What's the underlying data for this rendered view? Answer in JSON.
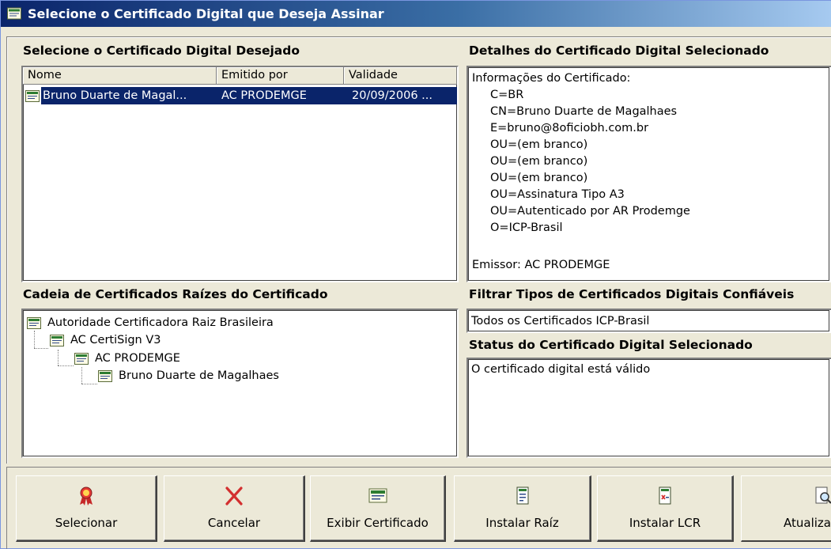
{
  "window": {
    "title": "Selecione o Certificado Digital que Deseja Assinar"
  },
  "certificates": {
    "label": "Selecione o Certificado Digital Desejado",
    "columns": [
      "Nome",
      "Emitido por",
      "Validade"
    ],
    "rows": [
      {
        "name": "Bruno Duarte de Magal...",
        "issuer": "AC PRODEMGE",
        "validity": "20/09/2006 ...",
        "selected": true
      }
    ]
  },
  "details": {
    "label": "Detalhes do Certificado Digital Selecionado",
    "lines": [
      "Informações do Certificado:",
      "C=BR",
      "CN=Bruno Duarte de Magalhaes",
      "E=bruno@8oficiobh.com.br",
      "OU=(em branco)",
      "OU=(em branco)",
      "OU=(em branco)",
      "OU=Assinatura Tipo A3",
      "OU=Autenticado por AR Prodemge",
      "O=ICP-Brasil"
    ],
    "issuer_line": "Emissor: AC PRODEMGE"
  },
  "chain": {
    "label": "Cadeia de Certificados Raízes do Certificado",
    "nodes": [
      "Autoridade Certificadora Raiz Brasileira",
      "AC CertiSign V3",
      "AC PRODEMGE",
      "Bruno Duarte de Magalhaes"
    ]
  },
  "filter": {
    "label": "Filtrar Tipos de Certificados Digitais Confiáveis",
    "value": "Todos os Certificados ICP-Brasil"
  },
  "status": {
    "label": "Status do Certificado Digital Selecionado",
    "text": "O certificado digital está válido"
  },
  "buttons": [
    {
      "label": "Selecionar",
      "icon": "award-ribbon-icon"
    },
    {
      "label": "Cancelar",
      "icon": "red-x-icon"
    },
    {
      "label": "Exibir Certificado",
      "icon": "certificate-icon"
    },
    {
      "label": "Instalar Raíz",
      "icon": "install-document-icon"
    },
    {
      "label": "Instalar LCR",
      "icon": "revocation-list-icon"
    },
    {
      "label": "Atualiza",
      "icon": "magnifier-document-icon"
    }
  ],
  "colors": {
    "selection": "#0a246a",
    "titlebar": "#0a246a",
    "dialog": "#ece9d8"
  }
}
